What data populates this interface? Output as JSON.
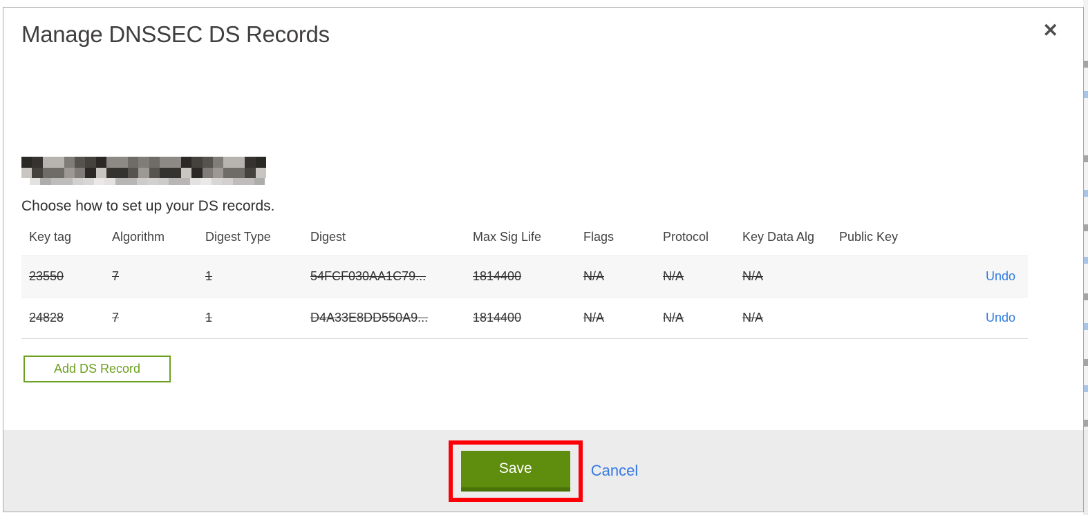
{
  "modal": {
    "title": "Manage DNSSEC DS Records",
    "close_icon": "✕",
    "domain": {
      "redacted": true
    },
    "subtitle": "Choose how to set up your DS records.",
    "table": {
      "headers": [
        "Key tag",
        "Algorithm",
        "Digest Type",
        "Digest",
        "Max Sig Life",
        "Flags",
        "Protocol",
        "Key Data Alg",
        "Public Key"
      ],
      "rows": [
        {
          "key_tag": "23550",
          "algorithm": "7",
          "digest_type": "1",
          "digest": "54FCF030AA1C79...",
          "max_sig_life": "1814400",
          "flags": "N/A",
          "protocol": "N/A",
          "key_data_alg": "N/A",
          "public_key": "",
          "action": "Undo",
          "pending_deletion": true
        },
        {
          "key_tag": "24828",
          "algorithm": "7",
          "digest_type": "1",
          "digest": "D4A33E8DD550A9...",
          "max_sig_life": "1814400",
          "flags": "N/A",
          "protocol": "N/A",
          "key_data_alg": "N/A",
          "public_key": "",
          "action": "Undo",
          "pending_deletion": true
        }
      ]
    },
    "add_button_label": "Add DS Record",
    "footer": {
      "save_label": "Save",
      "cancel_label": "Cancel"
    }
  },
  "annotation": {
    "type": "rectangle",
    "color": "#fb0007",
    "target": "save-button"
  },
  "colors": {
    "save_green": "#5f8d0e",
    "save_green_dark": "#4a7209",
    "outline_green": "#6ca021",
    "link_blue": "#2e7cde",
    "footer_gray": "#ececec",
    "row_stripe_gray": "#f7f7f7",
    "annotation_red": "#fb0007",
    "modal_border_gray": "#a8a8a8"
  },
  "redaction": {
    "palette": [
      "#2b2926",
      "#6f6b66",
      "#9d9893",
      "#45423e",
      "#b7b4b0",
      "#807c77",
      "#35332f",
      "#c9c6c2",
      "#56534f",
      "#8d8984"
    ]
  }
}
